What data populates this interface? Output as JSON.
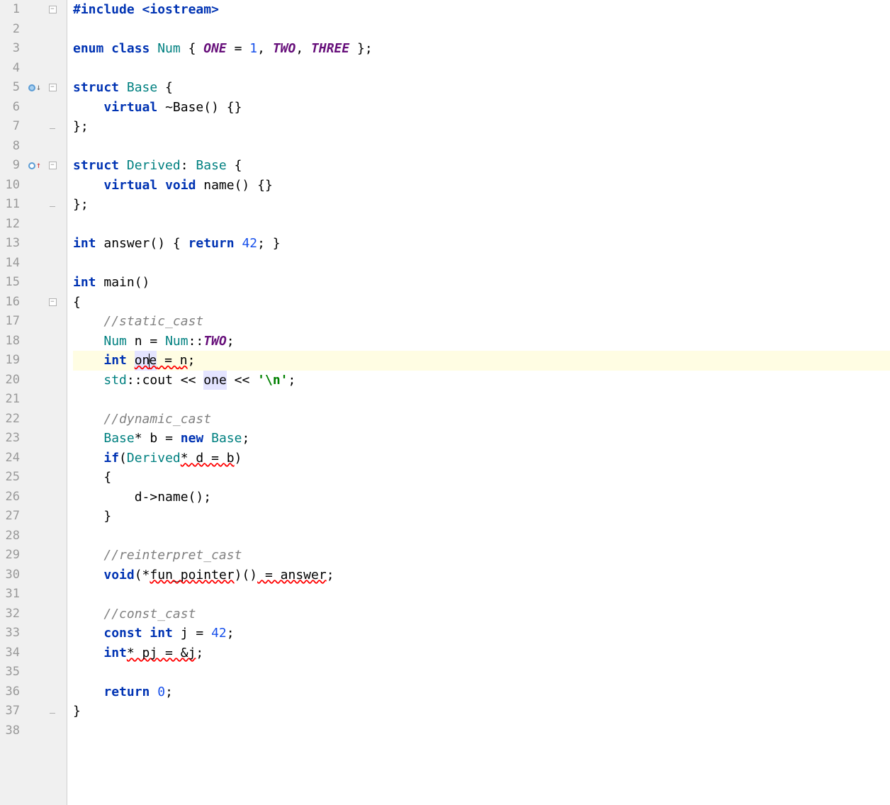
{
  "lines": [
    {
      "n": 1,
      "fold": "minus"
    },
    {
      "n": 2
    },
    {
      "n": 3
    },
    {
      "n": 4
    },
    {
      "n": 5,
      "marker": "override-down",
      "fold": "minus"
    },
    {
      "n": 6
    },
    {
      "n": 7,
      "fold": "end"
    },
    {
      "n": 8
    },
    {
      "n": 9,
      "marker": "override-up",
      "fold": "minus"
    },
    {
      "n": 10
    },
    {
      "n": 11,
      "fold": "end"
    },
    {
      "n": 12
    },
    {
      "n": 13
    },
    {
      "n": 14
    },
    {
      "n": 15
    },
    {
      "n": 16,
      "fold": "minus"
    },
    {
      "n": 17
    },
    {
      "n": 18,
      "bulb": true
    },
    {
      "n": 19,
      "highlighted": true
    },
    {
      "n": 20
    },
    {
      "n": 21
    },
    {
      "n": 22
    },
    {
      "n": 23
    },
    {
      "n": 24
    },
    {
      "n": 25
    },
    {
      "n": 26
    },
    {
      "n": 27
    },
    {
      "n": 28
    },
    {
      "n": 29
    },
    {
      "n": 30
    },
    {
      "n": 31
    },
    {
      "n": 32
    },
    {
      "n": 33
    },
    {
      "n": 34
    },
    {
      "n": 35
    },
    {
      "n": 36
    },
    {
      "n": 37,
      "fold": "end"
    },
    {
      "n": 38
    }
  ],
  "code": {
    "l1": {
      "include": "#include ",
      "hdr": "<iostream>"
    },
    "l3": {
      "kw1": "enum class ",
      "type": "Num",
      "txt1": " { ",
      "e1": "ONE",
      "eq": " = ",
      "v1": "1",
      "c1": ", ",
      "e2": "TWO",
      "c2": ", ",
      "e3": "THREE",
      "end": " };"
    },
    "l5": {
      "kw": "struct ",
      "type": "Base",
      "txt": " {"
    },
    "l6": {
      "pad": "    ",
      "kw": "virtual ",
      "dtor": "~Base() {}"
    },
    "l7": {
      "txt": "};"
    },
    "l9": {
      "kw": "struct ",
      "type": "Derived",
      "colon": ": ",
      "base": "Base",
      "txt": " {"
    },
    "l10": {
      "pad": "    ",
      "kw1": "virtual ",
      "kw2": "void ",
      "fn": "name() {}"
    },
    "l11": {
      "txt": "};"
    },
    "l13": {
      "kw1": "int ",
      "fn": "answer() { ",
      "kw2": "return ",
      "v": "42",
      "end": "; }"
    },
    "l15": {
      "kw": "int ",
      "fn": "main()"
    },
    "l16": {
      "txt": "{"
    },
    "l17": {
      "pad": "    ",
      "c": "//static_cast"
    },
    "l18": {
      "pad": "    ",
      "type": "Num",
      "var": " n = ",
      "ns": "Num",
      "sc": "::",
      "val": "TWO",
      "end": ";"
    },
    "l19": {
      "pad": "    ",
      "kw": "int ",
      "var": "one",
      "eq": " = ",
      "rhs": "n",
      "end": ";"
    },
    "l20": {
      "pad": "    ",
      "ns": "std",
      "sc": "::",
      "cout": "cout",
      "op1": " << ",
      "var": "one",
      "op2": " << ",
      "str": "'\\n'",
      "end": ";"
    },
    "l22": {
      "pad": "    ",
      "c": "//dynamic_cast"
    },
    "l23": {
      "pad": "    ",
      "type": "Base",
      "ptr": "* b = ",
      "kw": "new ",
      "type2": "Base",
      "end": ";"
    },
    "l24": {
      "pad": "    ",
      "kw": "if",
      "p1": "(",
      "type": "Derived",
      "err": "* d = b",
      "p2": ")"
    },
    "l25": {
      "pad": "    ",
      "txt": "{"
    },
    "l26": {
      "pad": "        ",
      "txt": "d->name();"
    },
    "l27": {
      "pad": "    ",
      "txt": "}"
    },
    "l29": {
      "pad": "    ",
      "c": "//reinterpret_cast"
    },
    "l30": {
      "pad": "    ",
      "kw": "void",
      "p1": "(*",
      "err1": "fun_pointer",
      "p2": ")()",
      "err2": " = answer",
      "end": ";"
    },
    "l32": {
      "pad": "    ",
      "c": "//const_cast"
    },
    "l33": {
      "pad": "    ",
      "kw": "const int ",
      "var": "j = ",
      "v": "42",
      "end": ";"
    },
    "l34": {
      "pad": "    ",
      "kw": "int",
      "err": "* pj = &j",
      "end": ";"
    },
    "l36": {
      "pad": "    ",
      "kw": "return ",
      "v": "0",
      "end": ";"
    },
    "l37": {
      "txt": "}"
    }
  }
}
